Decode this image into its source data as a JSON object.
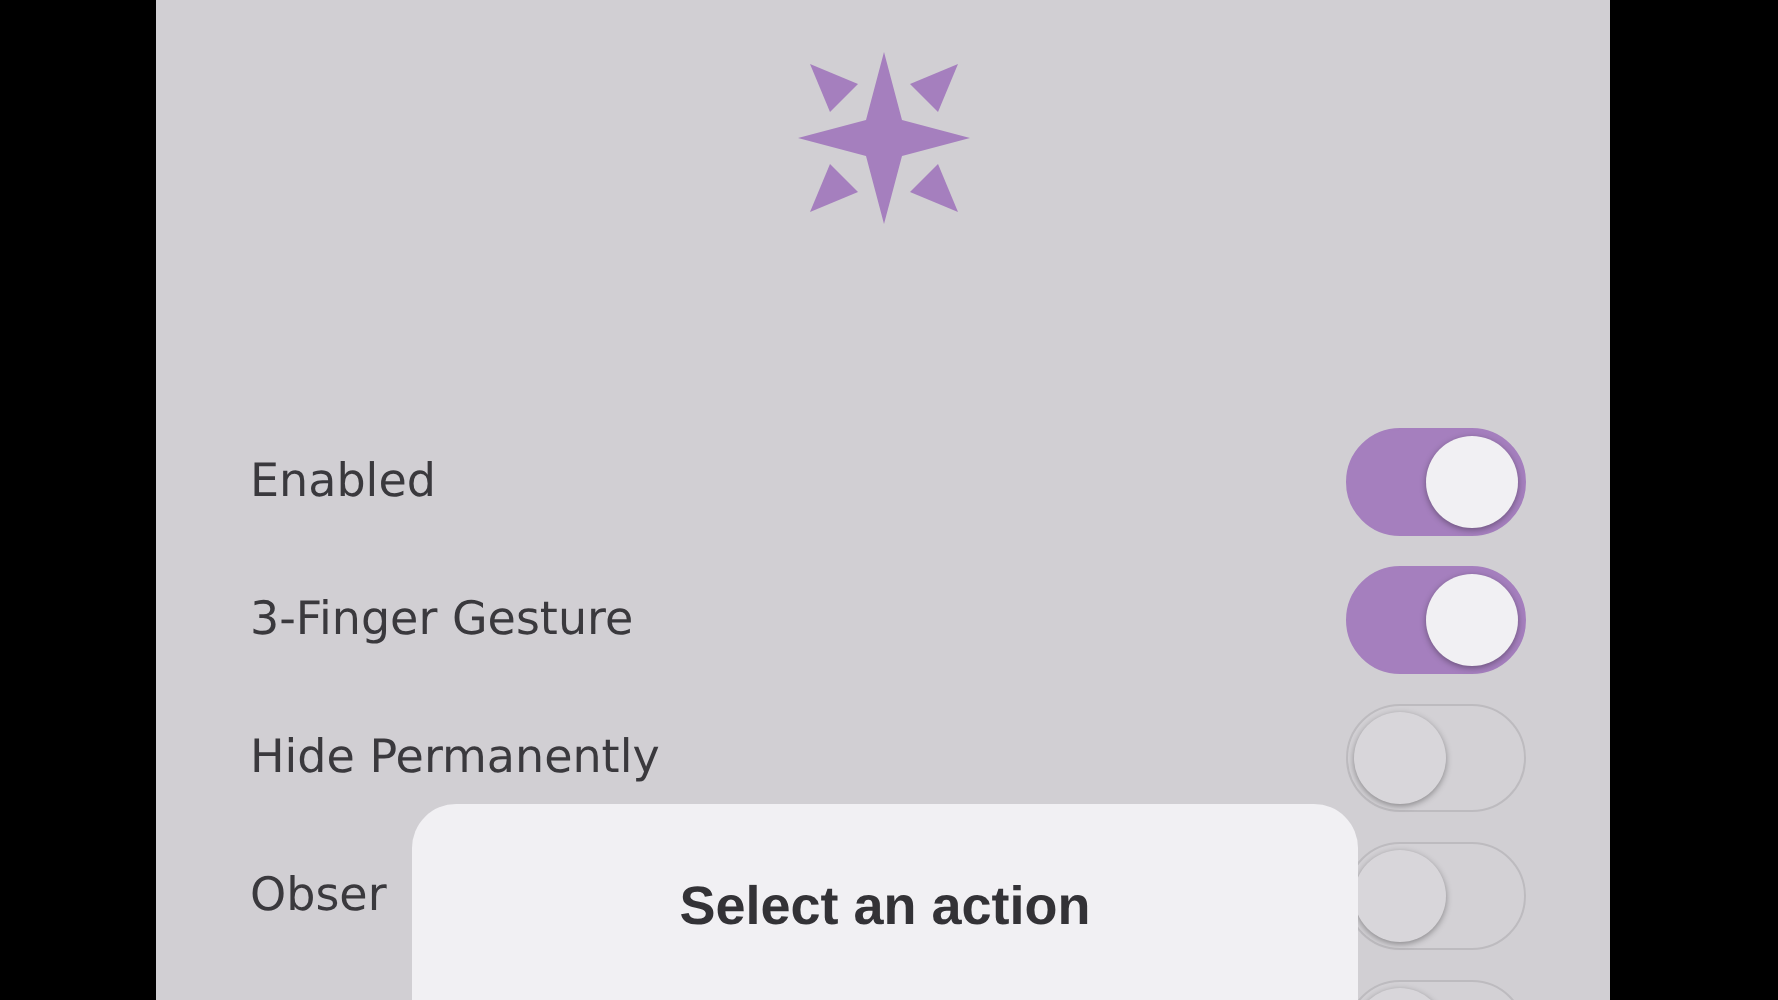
{
  "settings": [
    {
      "kind": "toggle",
      "label": "Enabled",
      "on": true
    },
    {
      "kind": "toggle",
      "label": "3-Finger Gesture",
      "on": true
    },
    {
      "kind": "toggle",
      "label": "Hide Permanently",
      "on": false
    },
    {
      "kind": "toggle",
      "label": "Obser",
      "on": false
    },
    {
      "kind": "toggle",
      "on": false
    }
  ],
  "action_sheet": {
    "title": "Select an action"
  }
}
